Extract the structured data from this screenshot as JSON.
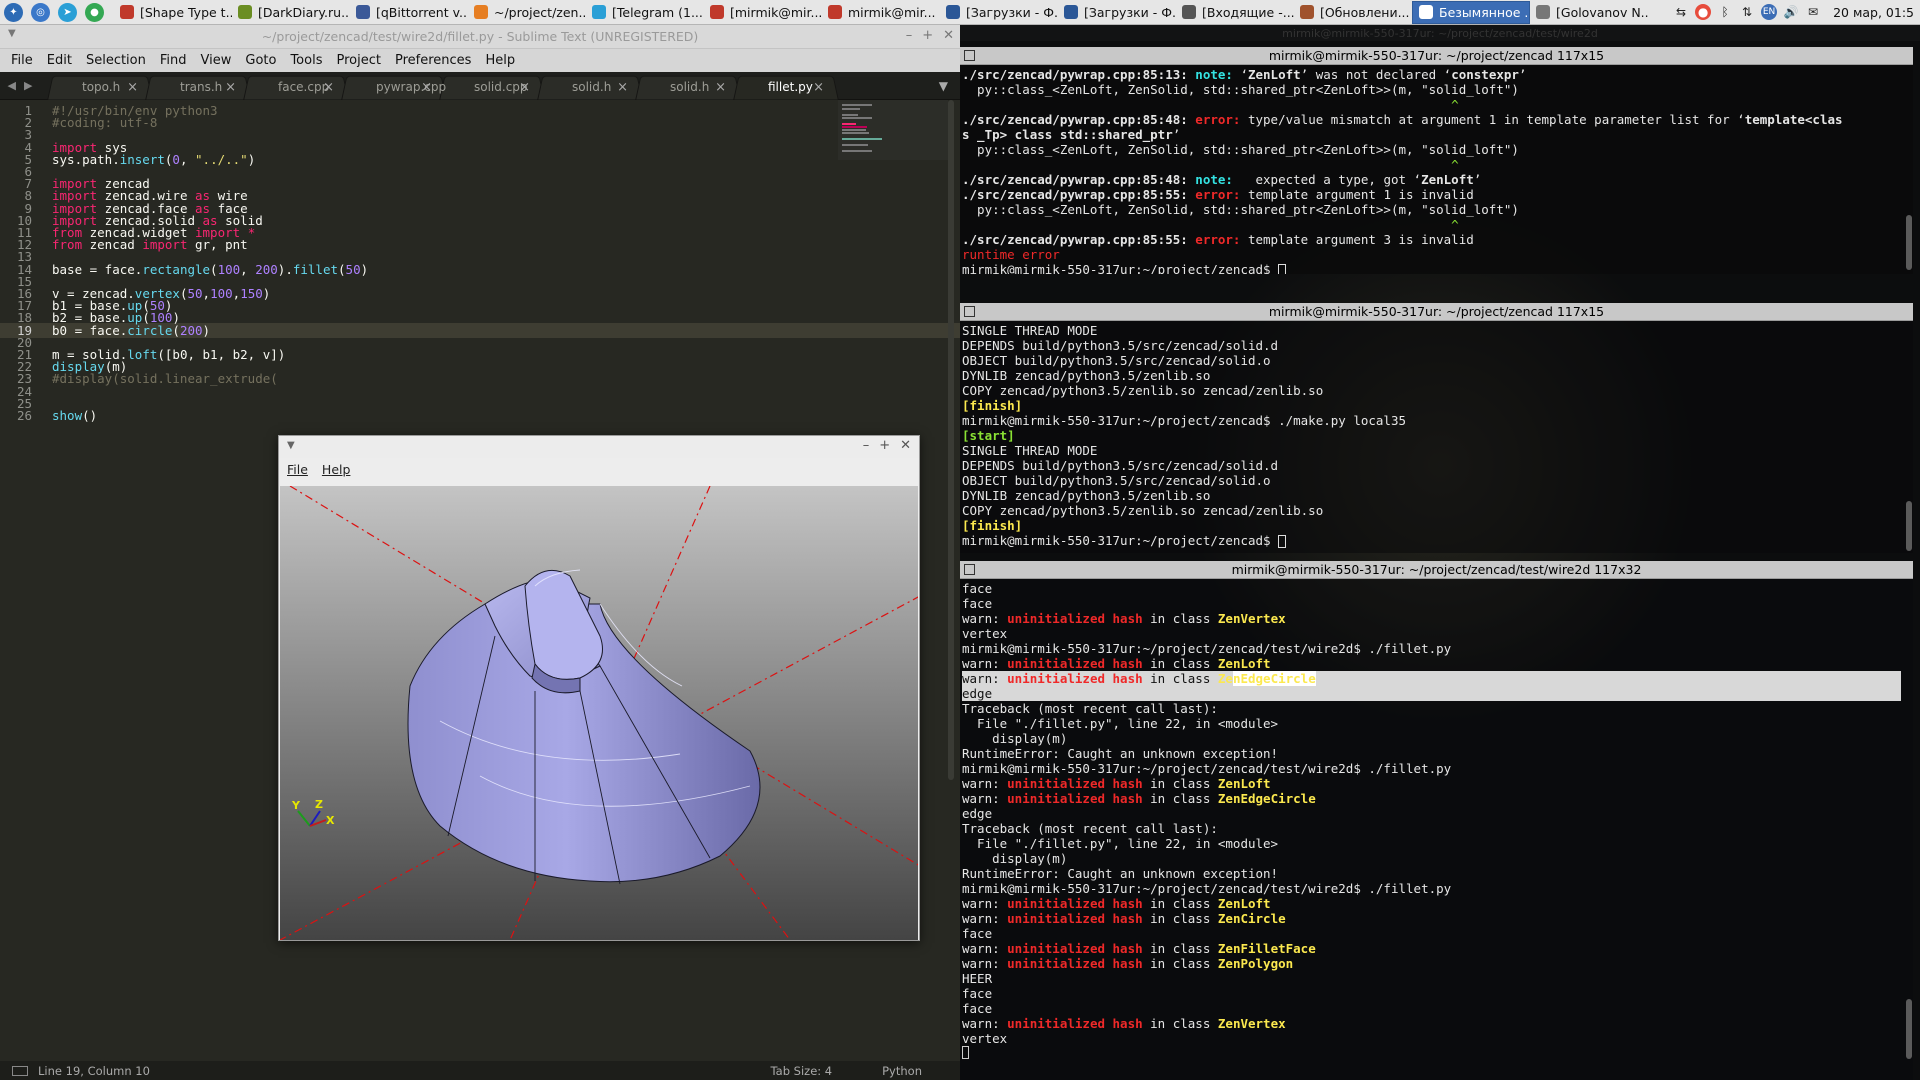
{
  "taskbar": {
    "tasks": [
      {
        "label": "[Shape Type t...",
        "color": "#c0392b"
      },
      {
        "label": "[DarkDiary.ru...",
        "color": "#6b8e23"
      },
      {
        "label": "[qBittorrent v...",
        "color": "#3b5998"
      },
      {
        "label": "~/project/zen...",
        "color": "#e67e22"
      },
      {
        "label": "[Telegram (1...",
        "color": "#2a9fd6"
      },
      {
        "label": "[mirmik@mir...",
        "color": "#c0392b"
      },
      {
        "label": "mirmik@mir...",
        "color": "#c0392b"
      },
      {
        "label": "[Загрузки - Ф...",
        "color": "#2b5797"
      },
      {
        "label": "[Загрузки - Ф...",
        "color": "#2b5797"
      },
      {
        "label": "[Входящие -...",
        "color": "#555555"
      },
      {
        "label": "[Обновлени...",
        "color": "#a0522d"
      },
      {
        "label": "Безымянное ...",
        "color": "#ffffff"
      },
      {
        "label": "[Golovanov N...",
        "color": "#777777"
      }
    ],
    "clock": "20 мар, 01:5"
  },
  "sublime": {
    "title": "~/project/zencad/test/wire2d/fillet.py - Sublime Text (UNREGISTERED)",
    "menu": [
      "File",
      "Edit",
      "Selection",
      "Find",
      "View",
      "Goto",
      "Tools",
      "Project",
      "Preferences",
      "Help"
    ],
    "tabs": [
      {
        "label": "topo.h"
      },
      {
        "label": "trans.h"
      },
      {
        "label": "face.cpp"
      },
      {
        "label": "pywrap.cpp"
      },
      {
        "label": "solid.cpp"
      },
      {
        "label": "solid.h"
      },
      {
        "label": "solid.h"
      },
      {
        "label": "fillet.py"
      }
    ],
    "status_left": "Line 19, Column 10",
    "status_tab": "Tab Size: 4",
    "status_lang": "Python",
    "colors": {
      "keyword": "#f92672",
      "func": "#66d9ef",
      "number": "#ae81ff",
      "string": "#e6db74",
      "comment": "#75715e",
      "text": "#f8f8f2"
    }
  },
  "code_lines": [
    "#!/usr/bin/env python3",
    "#coding: utf-8",
    "",
    "import sys",
    "sys.path.insert(0, \"../..\")",
    "",
    "import zencad",
    "import zencad.wire as wire",
    "import zencad.face as face",
    "import zencad.solid as solid",
    "from zencad.widget import *",
    "from zencad import gr, pnt",
    "",
    "base = face.rectangle(100, 200).fillet(50)",
    "",
    "v = zencad.vertex(50,100,150)",
    "b1 = base.up(50)",
    "b2 = base.up(100)",
    "b0 = face.circle(200)",
    "",
    "m = solid.loft([b0, b1, b2, v])",
    "display(m)",
    "#display(solid.linear_extrude(",
    "",
    "",
    "show()"
  ],
  "viewer": {
    "menu": [
      "File",
      "Help"
    ],
    "axes": {
      "x": "X",
      "y": "Y",
      "z": "Z"
    },
    "shape_color": "#a7a7e0"
  },
  "terminal": {
    "window_title": "mirmik@mirmik-550-317ur: ~/project/zencad/test/wire2d",
    "panes": [
      {
        "title": "mirmik@mirmik-550-317ur: ~/project/zencad 117x15",
        "lines": [
          [
            {
              "t": "./src/zencad/pywrap.cpp:85:13: ",
              "b": 1
            },
            {
              "t": "note: ",
              "c": "#34e2e2",
              "b": 1
            },
            {
              "t": "‘"
            },
            {
              "t": "ZenLoft",
              "b": 1
            },
            {
              "t": "’ was not declared ‘"
            },
            {
              "t": "constexpr",
              "b": 1
            },
            {
              "t": "’"
            }
          ],
          [
            {
              "t": "  py::class_<ZenLoft, ZenSolid, std::shared_ptr<ZenLoft>>(m, \"solid_loft\")"
            }
          ],
          [
            {
              "t": "                                                                 ^",
              "c": "#8ae234"
            }
          ],
          [
            {
              "t": "./src/zencad/pywrap.cpp:85:48: ",
              "b": 1
            },
            {
              "t": "error: ",
              "c": "#ef2929",
              "b": 1
            },
            {
              "t": "type/value mismatch at argument 1 in template parameter list for ‘"
            },
            {
              "t": "template<clas",
              "b": 1
            }
          ],
          [
            {
              "t": "s _Tp> class std::shared_ptr",
              "b": 1
            },
            {
              "t": "’"
            }
          ],
          [
            {
              "t": "  py::class_<ZenLoft, ZenSolid, std::shared_ptr<ZenLoft>>(m, \"solid_loft\")"
            }
          ],
          [
            {
              "t": "                                                                 ^",
              "c": "#8ae234"
            }
          ],
          [
            {
              "t": "./src/zencad/pywrap.cpp:85:48: ",
              "b": 1
            },
            {
              "t": "note: ",
              "c": "#34e2e2",
              "b": 1
            },
            {
              "t": "  expected a type, got ‘"
            },
            {
              "t": "ZenLoft",
              "b": 1
            },
            {
              "t": "’"
            }
          ],
          [
            {
              "t": "./src/zencad/pywrap.cpp:85:55: ",
              "b": 1
            },
            {
              "t": "error: ",
              "c": "#ef2929",
              "b": 1
            },
            {
              "t": "template argument 1 is invalid"
            }
          ],
          [
            {
              "t": "  py::class_<ZenLoft, ZenSolid, std::shared_ptr<ZenLoft>>(m, \"solid_loft\")"
            }
          ],
          [
            {
              "t": "                                                                 ^",
              "c": "#8ae234"
            }
          ],
          [
            {
              "t": "./src/zencad/pywrap.cpp:85:55: ",
              "b": 1
            },
            {
              "t": "error: ",
              "c": "#ef2929",
              "b": 1
            },
            {
              "t": "template argument 3 is invalid"
            }
          ],
          [
            {
              "t": "runtime error",
              "c": "#ef2929"
            }
          ],
          [
            {
              "t": "mirmik@mirmik-550-317ur:~/project/zencad$ "
            },
            {
              "t": " ",
              "cur": 1
            }
          ]
        ]
      },
      {
        "title": "mirmik@mirmik-550-317ur: ~/project/zencad 117x15",
        "lines": [
          [
            {
              "t": "SINGLE THREAD MODE"
            }
          ],
          [
            {
              "t": "DEPENDS build/python3.5/src/zencad/solid.d"
            }
          ],
          [
            {
              "t": "OBJECT build/python3.5/src/zencad/solid.o"
            }
          ],
          [
            {
              "t": "DYNLIB zencad/python3.5/zenlib.so"
            }
          ],
          [
            {
              "t": "COPY zencad/python3.5/zenlib.so zencad/zenlib.so"
            }
          ],
          [
            {
              "t": "[finish]",
              "c": "#fce94f",
              "b": 1
            }
          ],
          [
            {
              "t": "mirmik@mirmik-550-317ur:~/project/zencad$ ./make.py local35"
            }
          ],
          [
            {
              "t": "[start]",
              "c": "#8ae234",
              "b": 1
            }
          ],
          [
            {
              "t": "SINGLE THREAD MODE"
            }
          ],
          [
            {
              "t": "DEPENDS build/python3.5/src/zencad/solid.d"
            }
          ],
          [
            {
              "t": "OBJECT build/python3.5/src/zencad/solid.o"
            }
          ],
          [
            {
              "t": "DYNLIB zencad/python3.5/zenlib.so"
            }
          ],
          [
            {
              "t": "COPY zencad/python3.5/zenlib.so zencad/zenlib.so"
            }
          ],
          [
            {
              "t": "[finish]",
              "c": "#fce94f",
              "b": 1
            }
          ],
          [
            {
              "t": "mirmik@mirmik-550-317ur:~/project/zencad$ "
            },
            {
              "t": " ",
              "cur": 1
            }
          ]
        ]
      },
      {
        "title": "mirmik@mirmik-550-317ur: ~/project/zencad/test/wire2d 117x32",
        "lines": [
          [
            {
              "t": "face"
            }
          ],
          [
            {
              "t": "face"
            }
          ],
          [
            {
              "t": "warn: "
            },
            {
              "t": "uninitialized hash",
              "c": "#ef2929",
              "b": 1
            },
            {
              "t": " in class "
            },
            {
              "t": "ZenVertex",
              "c": "#fce94f",
              "b": 1
            }
          ],
          [
            {
              "t": "vertex"
            }
          ],
          [
            {
              "t": "mirmik@mirmik-550-317ur:~/project/zencad/test/wire2d$ ./fillet.py"
            }
          ],
          [
            {
              "t": "warn: "
            },
            {
              "t": "uninitialized hash",
              "c": "#ef2929",
              "b": 1
            },
            {
              "t": " in class "
            },
            {
              "t": "ZenLoft",
              "c": "#fce94f",
              "b": 1
            }
          ],
          [
            {
              "t": "warn: "
            },
            {
              "t": "uninitialized hash",
              "c": "#ef2929",
              "b": 1
            },
            {
              "t": " in class "
            },
            {
              "t": "Ze",
              "c": "#fce94f",
              "b": 1
            },
            {
              "t": "nEdgeCircle",
              "c": "#fce94f",
              "b": 1,
              "sel": 1
            }
          ],
          [
            {
              "t": "edge",
              "dark": 1
            }
          ],
          [
            {
              "t": "Traceback (most recent call last):"
            }
          ],
          [
            {
              "t": "  File \"./fillet.py\", line 22, in <module>"
            }
          ],
          [
            {
              "t": "    display(m)"
            }
          ],
          [
            {
              "t": "RuntimeError: Caught an unknown exception!"
            }
          ],
          [
            {
              "t": "mirmik@mirmik-550-317ur:~/project/zencad/test/wire2d$ ./fillet.py"
            }
          ],
          [
            {
              "t": "warn: "
            },
            {
              "t": "uninitialized hash",
              "c": "#ef2929",
              "b": 1
            },
            {
              "t": " in class "
            },
            {
              "t": "ZenLoft",
              "c": "#fce94f",
              "b": 1
            }
          ],
          [
            {
              "t": "warn: "
            },
            {
              "t": "uninitialized hash",
              "c": "#ef2929",
              "b": 1
            },
            {
              "t": " in class "
            },
            {
              "t": "ZenEdgeCircle",
              "c": "#fce94f",
              "b": 1
            }
          ],
          [
            {
              "t": "edge"
            }
          ],
          [
            {
              "t": "Traceback (most recent call last):"
            }
          ],
          [
            {
              "t": "  File \"./fillet.py\", line 22, in <module>"
            }
          ],
          [
            {
              "t": "    display(m)"
            }
          ],
          [
            {
              "t": "RuntimeError: Caught an unknown exception!"
            }
          ],
          [
            {
              "t": "mirmik@mirmik-550-317ur:~/project/zencad/test/wire2d$ ./fillet.py"
            }
          ],
          [
            {
              "t": "warn: "
            },
            {
              "t": "uninitialized hash",
              "c": "#ef2929",
              "b": 1
            },
            {
              "t": " in class "
            },
            {
              "t": "ZenLoft",
              "c": "#fce94f",
              "b": 1
            }
          ],
          [
            {
              "t": "warn: "
            },
            {
              "t": "uninitialized hash",
              "c": "#ef2929",
              "b": 1
            },
            {
              "t": " in class "
            },
            {
              "t": "ZenCircle",
              "c": "#fce94f",
              "b": 1
            }
          ],
          [
            {
              "t": "face"
            }
          ],
          [
            {
              "t": "warn: "
            },
            {
              "t": "uninitialized hash",
              "c": "#ef2929",
              "b": 1
            },
            {
              "t": " in class "
            },
            {
              "t": "ZenFilletFace",
              "c": "#fce94f",
              "b": 1
            }
          ],
          [
            {
              "t": "warn: "
            },
            {
              "t": "uninitialized hash",
              "c": "#ef2929",
              "b": 1
            },
            {
              "t": " in class "
            },
            {
              "t": "ZenPolygon",
              "c": "#fce94f",
              "b": 1
            }
          ],
          [
            {
              "t": "HEER"
            }
          ],
          [
            {
              "t": "face"
            }
          ],
          [
            {
              "t": "face"
            }
          ],
          [
            {
              "t": "warn: "
            },
            {
              "t": "uninitialized hash",
              "c": "#ef2929",
              "b": 1
            },
            {
              "t": " in class "
            },
            {
              "t": "ZenVertex",
              "c": "#fce94f",
              "b": 1
            }
          ],
          [
            {
              "t": "vertex"
            }
          ],
          [
            {
              "t": " ",
              "cur": 2
            }
          ]
        ]
      }
    ]
  }
}
